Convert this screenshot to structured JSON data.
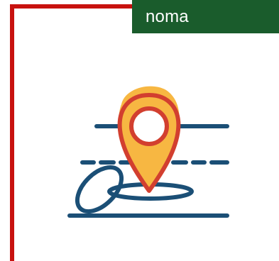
{
  "brand": {
    "label": "noma",
    "tab_color": "#1a5c2c"
  },
  "frame": {
    "color": "#c8120f"
  },
  "illustration": {
    "icon": "location-pin-icon",
    "pin_fill": "#f7b742",
    "pin_stroke": "#d23f2f",
    "line_color": "#1b4f76"
  }
}
